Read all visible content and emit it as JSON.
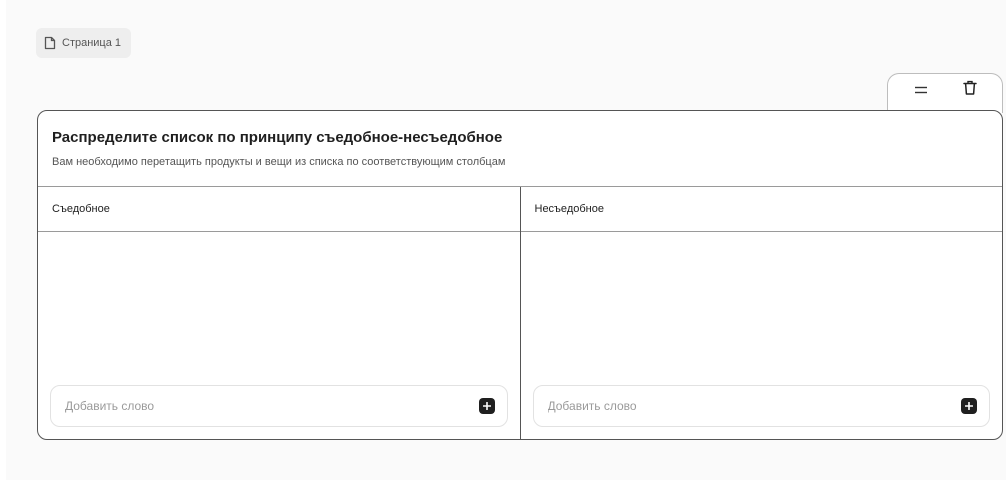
{
  "page_tab": {
    "label": "Страница 1",
    "icon": "document-icon"
  },
  "toolbar": {
    "icons": [
      "drag-handle-icon",
      "trash-icon"
    ]
  },
  "task": {
    "title": "Распределите список по принципу съедобное-несъедобное",
    "subtitle": "Вам необходимо перетащить продукты и вещи из списка по соответствующим столбцам"
  },
  "columns": [
    {
      "header": "Съедобное",
      "input_value": "",
      "input_placeholder": "Добавить слово"
    },
    {
      "header": "Несъедобное",
      "input_value": "",
      "input_placeholder": "Добавить слово"
    }
  ],
  "colors": {
    "border": "#555555",
    "button": "#1f1f1f",
    "background": "#fafafa"
  }
}
